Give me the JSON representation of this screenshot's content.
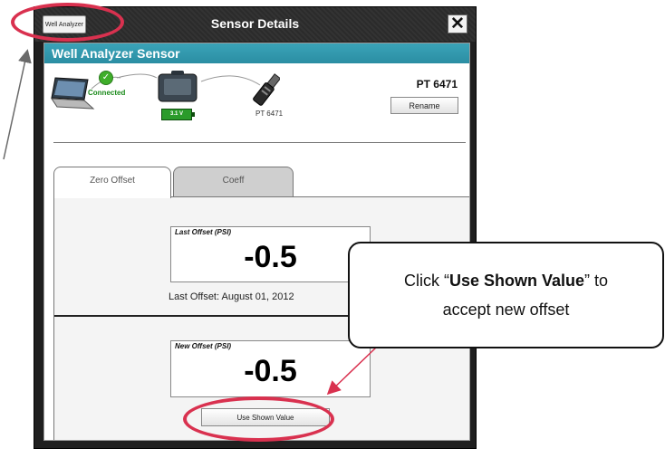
{
  "window": {
    "title": "Sensor Details",
    "back_label": "Well Analyzer",
    "close_label": "✕"
  },
  "section": {
    "header": "Well Analyzer Sensor"
  },
  "devices": {
    "connection_status": "Connected",
    "battery": "3.1 V",
    "sensor_small_label": "PT 6471",
    "sensor_id": "PT 6471",
    "rename_label": "Rename"
  },
  "tabs": [
    {
      "label": "Zero Offset",
      "selected": true
    },
    {
      "label": "Coeff",
      "selected": false
    }
  ],
  "last_offset": {
    "label": "Last Offset (PSI)",
    "value": "-0.5",
    "date_text": "Last Offset: August 01, 2012"
  },
  "new_offset": {
    "label": "New Offset (PSI)",
    "value": "-0.5",
    "button_label": "Use Shown Value"
  },
  "callout": {
    "prefix": "Click  “",
    "bold": "Use Shown Value",
    "suffix": "” to",
    "line2": "accept new offset"
  },
  "colors": {
    "accent": "#2b8ea3",
    "highlight": "#d9314f",
    "connected": "#1a8a1a"
  }
}
